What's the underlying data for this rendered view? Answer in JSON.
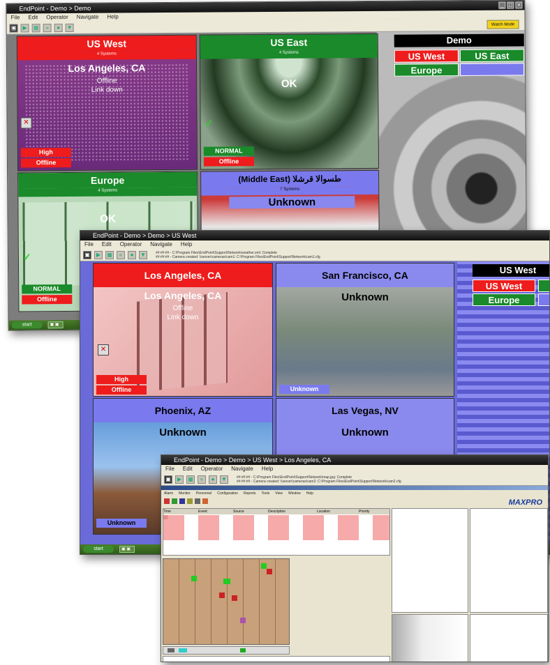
{
  "win1": {
    "title": "EndPoint - Demo > Demo",
    "menu": [
      "File",
      "Edit",
      "Operator",
      "Navigate",
      "Help"
    ],
    "toolbar_badge": "Watch Mode",
    "tiles": {
      "us_west": {
        "name": "US West",
        "systems": "4 Systems",
        "location": "Los Angeles, CA",
        "status1": "Offline",
        "status2": "Link down",
        "priority": "High",
        "state": "Offline"
      },
      "us_east": {
        "name": "US East",
        "systems": "4 Systems",
        "status": "OK",
        "priority": "NORMAL",
        "state": "Offline"
      },
      "europe": {
        "name": "Europe",
        "systems": "4 Systems",
        "status": "OK",
        "priority": "NORMAL",
        "state": "Offline"
      },
      "middle_east": {
        "name": "(Middle East) طسوالا قرشلا",
        "systems": "7 Systems",
        "status": "Unknown"
      }
    },
    "nav": {
      "title": "Demo",
      "buttons": [
        "US West",
        "US East",
        "Europe",
        ""
      ]
    }
  },
  "win2": {
    "title": "EndPoint - Demo > Demo > US West",
    "menu": [
      "File",
      "Edit",
      "Operator",
      "Navigate",
      "Help"
    ],
    "log": [
      "##:##:## - C:\\Program Files\\EndPoint\\Support\\Network\\weather.xml: Complete",
      "##:##:## - Camera created: \\\\server\\cameras\\cam1: C:\\Program Files\\EndPoint\\Support\\Network\\cam1.cfg"
    ],
    "tiles": {
      "la": {
        "name": "Los Angeles, CA",
        "location": "Los Angeles, CA",
        "status1": "Offline",
        "status2": "Link down",
        "priority": "High",
        "state": "Offline"
      },
      "sf": {
        "name": "San Francisco, CA",
        "status": "Unknown",
        "state": "Unknown"
      },
      "phx": {
        "name": "Phoenix, AZ",
        "status": "Unknown",
        "state": "Unknown"
      },
      "lv": {
        "name": "Las Vegas, NV",
        "status": "Unknown"
      }
    },
    "nav": {
      "title": "US West",
      "buttons": [
        "US West",
        "",
        "Europe",
        ""
      ]
    }
  },
  "win3": {
    "title": "EndPoint - Demo > Demo > US West > Los Angeles, CA",
    "menu": [
      "File",
      "Edit",
      "Operator",
      "Navigate",
      "Help"
    ],
    "log": [
      "##:##:## - C:\\Program Files\\EndPoint\\Support\\Network\\map.jpg: Complete",
      "##:##:## - Camera created: \\\\server\\cameras\\cam2: C:\\Program Files\\EndPoint\\Support\\Network\\cam2.cfg"
    ],
    "app_menu": [
      "Alarm",
      "Monitor",
      "Personnel",
      "Configuration",
      "Reports",
      "Tools",
      "View",
      "Window",
      "Help"
    ],
    "brand": "MAXPRO",
    "table_headers": [
      "Time",
      "Event",
      "Source",
      "Description",
      "Location",
      "Priority"
    ]
  },
  "colors": {
    "red": "#ee1c1c",
    "green": "#1a8a2a",
    "blue": "#7a7aee",
    "black": "#000000"
  }
}
